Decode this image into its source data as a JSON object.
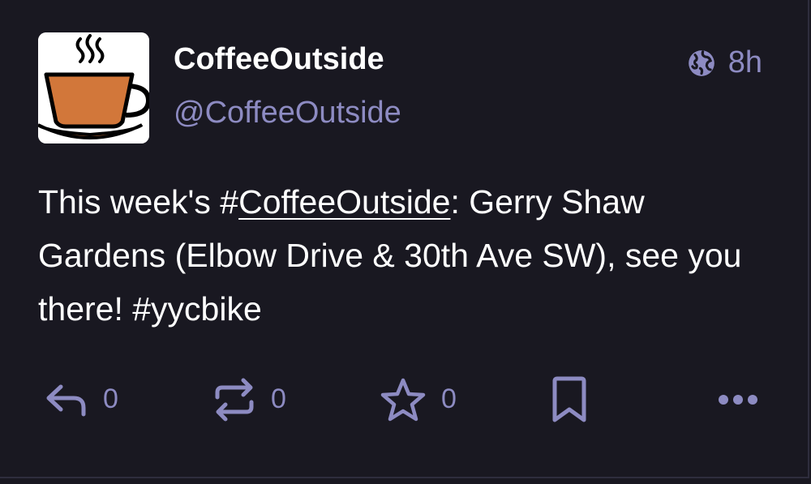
{
  "status": {
    "display_name": "CoffeeOutside",
    "handle": "@CoffeeOutside",
    "visibility_icon": "globe-icon",
    "relative_time": "8h",
    "content": {
      "part1": "This week's ",
      "hashtag1_hash": "#",
      "hashtag1_text": "CoffeeOutside",
      "part2": ": Gerry Shaw Gardens (Elbow Drive & 30th Ave SW), see you there! ",
      "hashtag2": "#yycbike"
    }
  },
  "actions": {
    "reply_icon": "reply-icon",
    "reply_count": "0",
    "boost_icon": "boost-icon",
    "boost_count": "0",
    "favourite_icon": "star-icon",
    "favourite_count": "0",
    "bookmark_icon": "bookmark-icon",
    "more_icon": "ellipsis-icon"
  },
  "colors": {
    "background": "#191821",
    "muted": "#8d8bc2",
    "text": "#ffffff",
    "coffee": "#d2773a"
  }
}
